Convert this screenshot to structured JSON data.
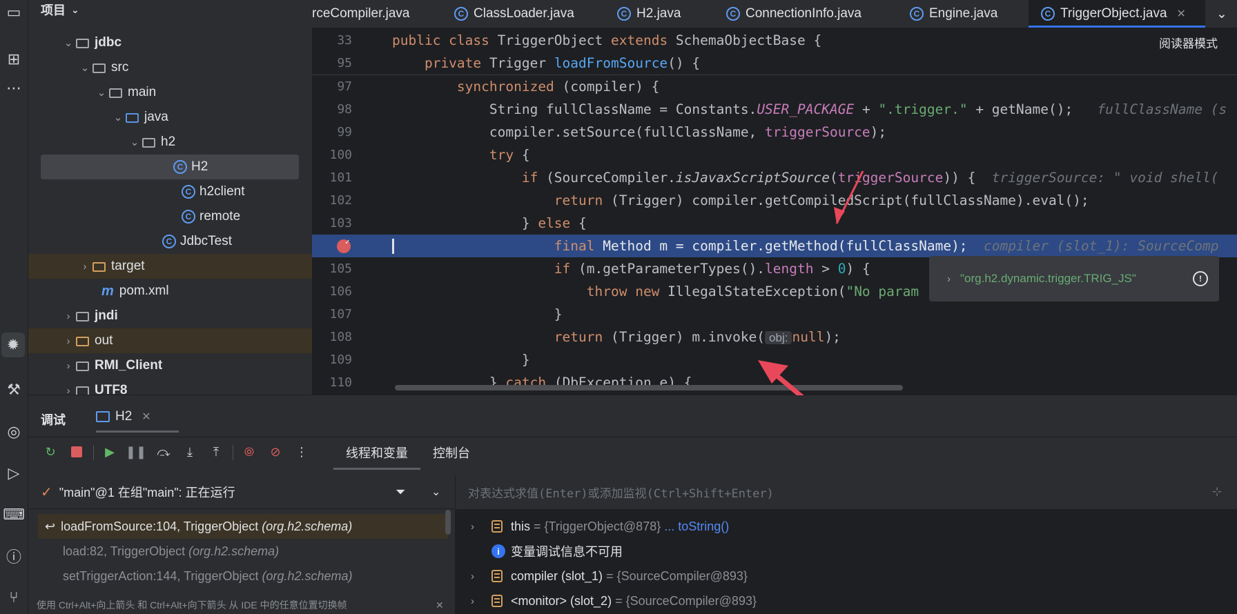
{
  "activity_bar": {
    "icons": [
      "folder-icon",
      "structure-icon",
      "more-icon",
      "debug-icon",
      "build-icon",
      "services-icon",
      "run-icon",
      "terminal-icon",
      "problems-icon",
      "git-icon"
    ]
  },
  "project": {
    "title": "项目",
    "tree": [
      {
        "label": "jdbc",
        "bold": true
      },
      {
        "label": "src"
      },
      {
        "label": "main"
      },
      {
        "label": "java"
      },
      {
        "label": "h2"
      },
      {
        "label": "H2"
      },
      {
        "label": "h2client"
      },
      {
        "label": "remote"
      },
      {
        "label": "JdbcTest"
      },
      {
        "label": "target"
      },
      {
        "label": "pom.xml"
      },
      {
        "label": "jndi",
        "bold": true
      },
      {
        "label": "out"
      },
      {
        "label": "RMI_Client",
        "bold": true
      },
      {
        "label": "UTF8",
        "bold": true
      }
    ]
  },
  "tabs": [
    {
      "label": "rceCompiler.java"
    },
    {
      "label": "ClassLoader.java"
    },
    {
      "label": "H2.java"
    },
    {
      "label": "ConnectionInfo.java"
    },
    {
      "label": "Engine.java"
    },
    {
      "label": "TriggerObject.java",
      "active": true
    }
  ],
  "editor": {
    "reader_mode": "阅读器模式",
    "line_numbers": [
      "33",
      "95",
      "97",
      "98",
      "99",
      "100",
      "101",
      "102",
      "103",
      "104",
      "105",
      "106",
      "107",
      "108",
      "109",
      "110"
    ],
    "code": {
      "l33_a": "public class ",
      "l33_b": "TriggerObject ",
      "l33_c": "extends ",
      "l33_d": "SchemaObjectBase {",
      "l95_a": "    private ",
      "l95_b": "Trigger ",
      "l95_c": "loadFromSource",
      "l95_d": "() {",
      "l97_a": "        synchronized ",
      "l97_b": "(compiler) {",
      "l98_a": "            String fullClassName = Constants.",
      "l98_b": "USER_PACKAGE",
      "l98_c": " + ",
      "l98_d": "\".trigger.\"",
      "l98_e": " + getName();",
      "l98_hint": "fullClassName (s",
      "l99_a": "            compiler.setSource(fullClassName, ",
      "l99_b": "triggerSource",
      "l99_c": ");",
      "l100_a": "            try ",
      "l100_b": "{",
      "l101_a": "                if ",
      "l101_b": "(SourceCompiler.",
      "l101_c": "isJavaxScriptSource",
      "l101_d": "(",
      "l101_e": "triggerSource",
      "l101_f": ")) {",
      "l101_hint": "triggerSource: \" void shell(",
      "l102_a": "                    return ",
      "l102_b": "(Trigger) compiler.getCompiledScript(fullClassName).eval();",
      "l103_a": "                } ",
      "l103_b": "else ",
      "l103_c": "{",
      "l104_a": "                    final ",
      "l104_b": "Method m = compiler.getMethod(fullClassName);",
      "l104_hint": "compiler (slot_1): SourceComp",
      "l105_a": "                    if ",
      "l105_b": "(m.getParameterTypes().",
      "l105_c": "length",
      "l105_d": " > ",
      "l105_e": "0",
      "l105_f": ") {",
      "l106_a": "                        throw ",
      "l106_b": "new ",
      "l106_c": "IllegalStateException(",
      "l106_d": "\"No param",
      "l107": "                    }",
      "l108_a": "                    return ",
      "l108_b": "(Trigger) m.invoke(",
      "l108_chip": "obj:",
      "l108_c": "null",
      "l108_d": ");",
      "l109": "                }",
      "l110_a": "            } ",
      "l110_b": "catch ",
      "l110_c": "(DbException e) {"
    },
    "popup_value": "\"org.h2.dynamic.trigger.TRIG_JS\""
  },
  "debug": {
    "title": "调试",
    "session_tab": "H2",
    "subtabs": [
      "线程和变量",
      "控制台"
    ],
    "thread": "\"main\"@1 在组\"main\": 正在运行",
    "frames": [
      {
        "method": "loadFromSource:104, TriggerObject",
        "pkg": "(org.h2.schema)"
      },
      {
        "method": "load:82, TriggerObject",
        "pkg": "(org.h2.schema)"
      },
      {
        "method": "setTriggerAction:144, TriggerObject",
        "pkg": "(org.h2.schema)"
      }
    ],
    "frames_hint": "使用 Ctrl+Alt+向上箭头 和 Ctrl+Alt+向下箭头 从 IDE 中的任意位置切换帧",
    "eval_placeholder": "对表达式求值(Enter)或添加监视(Ctrl+Shift+Enter)",
    "variables": [
      {
        "name": "this",
        "eq": " = ",
        "value": "{TriggerObject@878}",
        "link": " ... toString()"
      },
      {
        "name": "变量调试信息不可用"
      },
      {
        "name": "compiler (slot_1)",
        "eq": " = ",
        "value": "{SourceCompiler@893}"
      },
      {
        "name": "<monitor> (slot_2)",
        "eq": " = ",
        "value": "{SourceCompiler@893}"
      }
    ]
  },
  "colors": {
    "accent": "#3574f0",
    "exec_line": "#2d4a86",
    "arrow": "#e8485a",
    "breakpoint": "#db5c5c"
  }
}
